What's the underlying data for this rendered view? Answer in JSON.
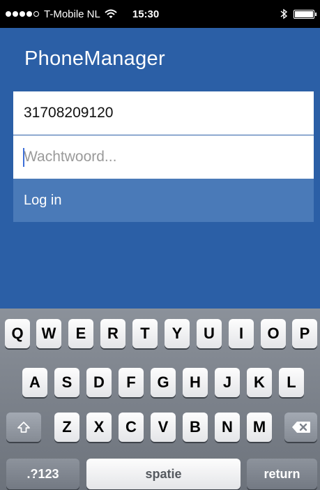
{
  "status_bar": {
    "carrier": "T-Mobile NL",
    "time": "15:30",
    "signal_bars_filled": 4,
    "signal_bars_total": 5
  },
  "app": {
    "title": "PhoneManager",
    "phone_field": {
      "value": "31708209120",
      "placeholder": ""
    },
    "password_field": {
      "value": "",
      "placeholder": "Wachtwoord..."
    },
    "login_label": "Log in",
    "colors": {
      "background": "#2b5fa6",
      "button": "#4a7ab8"
    }
  },
  "keyboard": {
    "row1": [
      "Q",
      "W",
      "E",
      "R",
      "T",
      "Y",
      "U",
      "I",
      "O",
      "P"
    ],
    "row2": [
      "A",
      "S",
      "D",
      "F",
      "G",
      "H",
      "J",
      "K",
      "L"
    ],
    "row3": [
      "Z",
      "X",
      "C",
      "V",
      "B",
      "N",
      "M"
    ],
    "numbers_label": ".?123",
    "space_label": "spatie",
    "return_label": "return",
    "shift_icon": "shift-icon",
    "backspace_icon": "backspace-icon"
  }
}
